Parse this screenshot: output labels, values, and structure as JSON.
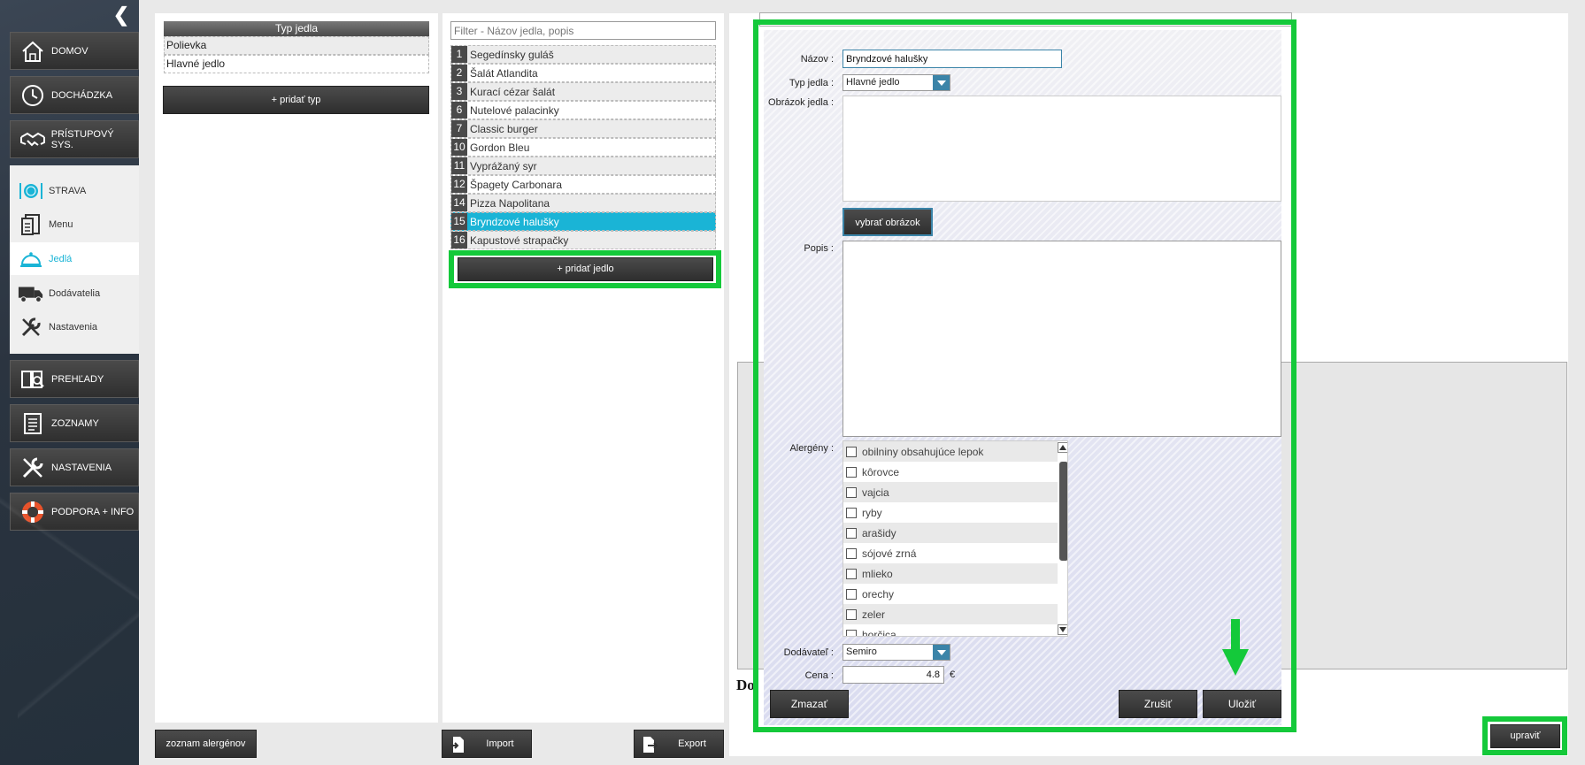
{
  "sidebar": {
    "collapse_icon": "chevron-left-icon",
    "main_items": [
      {
        "label": "DOMOV",
        "icon": "home-icon"
      },
      {
        "label": "DOCHÁDZKA",
        "icon": "clock-icon"
      },
      {
        "label": "PRÍSTUPOVÝ SYS.",
        "icon": "handshake-icon"
      },
      {
        "label": "PREHĽADY",
        "icon": "book-search-icon"
      },
      {
        "label": "ZOZNAMY",
        "icon": "list-icon"
      },
      {
        "label": "NASTAVENIA",
        "icon": "tools-icon"
      },
      {
        "label": "PODPORA + INFO",
        "icon": "lifebuoy-icon"
      }
    ],
    "strava_section": [
      {
        "label": "STRAVA",
        "icon": "plate-icon"
      },
      {
        "label": "Menu",
        "icon": "menu-doc-icon"
      },
      {
        "label": "Jedlá",
        "icon": "cloche-icon",
        "active": true
      },
      {
        "label": "Dodávatelia",
        "icon": "truck-icon"
      },
      {
        "label": "Nastavenia",
        "icon": "wrench-icon"
      }
    ]
  },
  "types_panel": {
    "header": "Typ jedla",
    "rows": [
      "Polievka",
      "Hlavné jedlo"
    ],
    "add_button": "+ pridať typ",
    "allergens_button": "zoznam alergénov"
  },
  "foods_panel": {
    "filter_placeholder": "Filter - Názov jedla, popis",
    "items": [
      {
        "num": "1",
        "name": "Segedínsky guláš"
      },
      {
        "num": "2",
        "name": "Šalát Atlandita"
      },
      {
        "num": "3",
        "name": "Kurací cézar šalát"
      },
      {
        "num": "6",
        "name": "Nutelové palacinky"
      },
      {
        "num": "7",
        "name": "Classic burger"
      },
      {
        "num": "10",
        "name": "Gordon Bleu"
      },
      {
        "num": "11",
        "name": "Vyprážaný syr"
      },
      {
        "num": "12",
        "name": "Špagety Carbonara"
      },
      {
        "num": "14",
        "name": "Pizza Napolitana"
      },
      {
        "num": "15",
        "name": "Bryndzové halušky",
        "selected": true
      },
      {
        "num": "16",
        "name": "Kapustové strapačky"
      }
    ],
    "add_button": "+ pridať jedlo",
    "import_button": "Import",
    "export_button": "Export"
  },
  "detail_panel": {
    "partial_heading": "Do",
    "edit_button": "upraviť"
  },
  "dialog": {
    "name_label": "Názov :",
    "name_value": "Bryndzové halušky",
    "type_label": "Typ jedla :",
    "type_value": "Hlavné jedlo",
    "image_label": "Obrázok jedla :",
    "choose_image_button": "vybrať obrázok",
    "desc_label": "Popis :",
    "allergens_label": "Alergény :",
    "allergens": [
      "obilniny obsahujúce lepok",
      "kôrovce",
      "vajcia",
      "ryby",
      "arašidy",
      "sójové zrná",
      "mlieko",
      "orechy",
      "zeler",
      "horčica"
    ],
    "supplier_label": "Dodávateľ :",
    "supplier_value": "Semiro",
    "price_label": "Cena :",
    "price_value": "4.8",
    "currency": "€",
    "delete_button": "Zmazať",
    "cancel_button": "Zrušiť",
    "save_button": "Uložiť"
  },
  "colors": {
    "accent": "#1ab4d6",
    "highlight_frame": "#14c93a",
    "dropdown_arrow": "#3b84a8"
  }
}
